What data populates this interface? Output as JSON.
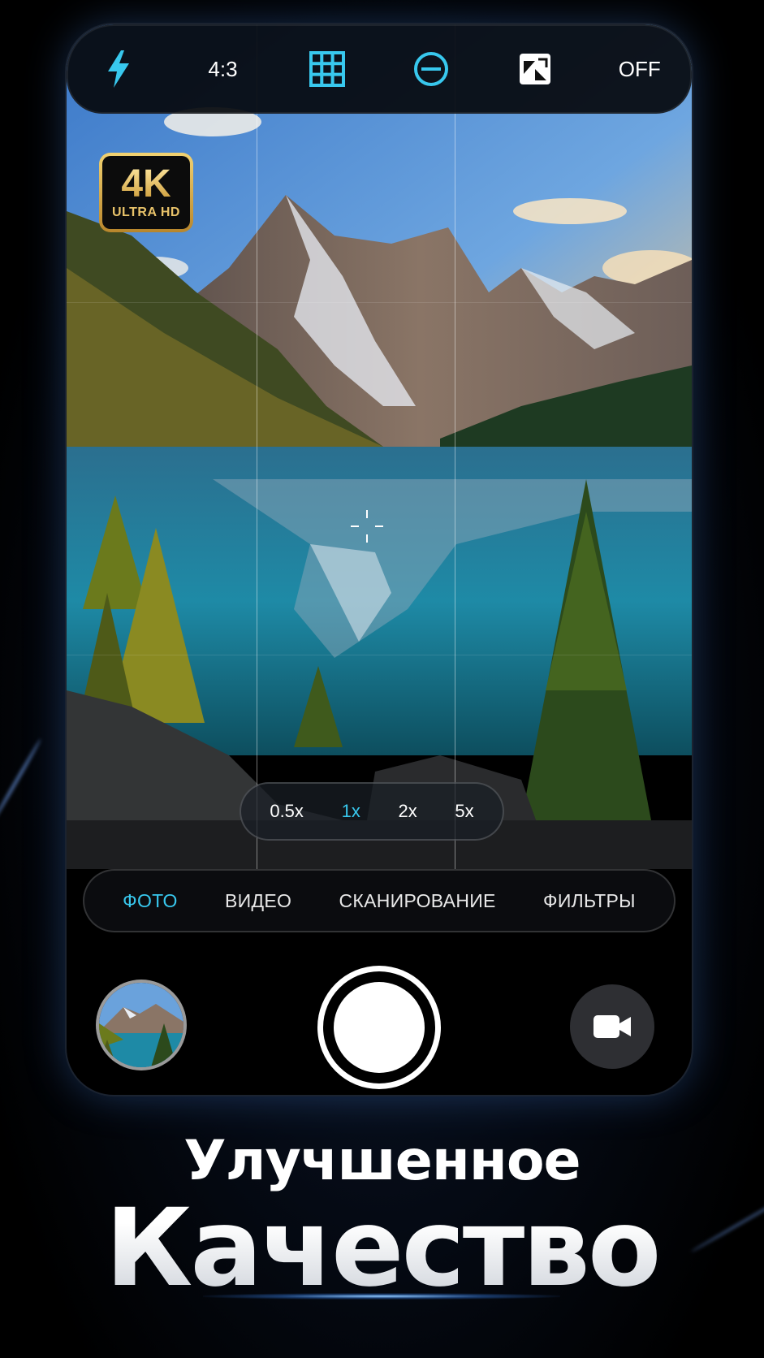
{
  "topbar": {
    "flash_icon": "flash-icon",
    "aspect_ratio": "4:3",
    "grid_icon": "grid-icon",
    "exposure_icon": "exposure-icon",
    "hdr_icon": "hdr-icon",
    "timer_status": "OFF"
  },
  "badge": {
    "main": "4K",
    "sub": "ULTRA HD"
  },
  "zoom": {
    "options": [
      "0.5x",
      "1x",
      "2x",
      "5x"
    ],
    "selected": "1x"
  },
  "modes": {
    "items": [
      "ФОТО",
      "ВИДЕО",
      "СКАНИРОВАНИЕ",
      "ФИЛЬТРЫ"
    ],
    "selected": "ФОТО"
  },
  "controls": {
    "gallery_icon": "gallery-thumbnail",
    "shutter_icon": "shutter-button",
    "video_icon": "video-camera-icon"
  },
  "headline": {
    "line1": "Улучшенное",
    "line2": "Качество"
  },
  "colors": {
    "accent": "#38c8ee",
    "background": "#000000",
    "badge_gold": "#e9c36a"
  }
}
